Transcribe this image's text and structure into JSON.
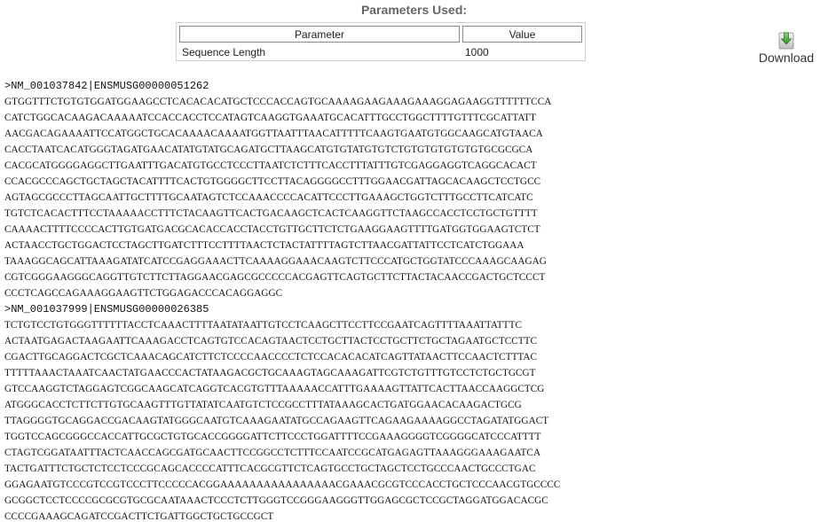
{
  "parameters": {
    "title": "Parameters Used:",
    "columns": [
      "Parameter",
      "Value"
    ],
    "rows": [
      {
        "parameter": "Sequence Length",
        "value": "1000"
      }
    ]
  },
  "download": {
    "label": "Download",
    "icon": "download-arrow-icon"
  },
  "records": [
    {
      "header": ">NM_001037842|ENSMUSG00000051262",
      "lines": [
        "GTGGTTTCTGTGTGGATGGAAGCCTCACACACATGCTCCCACCAGTGCAAAAGAAGAAAGAAAGGAGAAGGTTTTTTCCA",
        "CATCTGGCACAAGACAAAAATCCACCACCTCCATAGTCAAGGTGAAATGCACATTTGCCTGGCTTTTGTTTCGCATTATT",
        "AACGACAGAAAATTCCATGGCTGCACAAAACAAAATGGTTAATTTAACATTTTTCAAGTGAATGTGGCAAGCATGTAACA",
        "CACCTAATCACATGGGTAGATGAACATATGTATGCAGATGCTTAAGCATGTGTATGTGTCTGTGTGTGTGTGTGCGCGCA",
        "CACGCATGGGGAGGCTTGAATTTGACATGTGCCTCCCTTAATCTCTTTCACCTTTATTTGTCGAGGAGGTCAGGCACACT",
        "CCACGCCCAGCTGCTAGCTACATTTTCACTGTGGGGCTTCCTTACAGGGGCCTTTGGAACGATTAGCACAAGCTCCTGCC",
        "AGTAGCGCCCTTAGCAATTGCTTTTGCAATAGTCTCCAAACCCCACATTCCCTTGAAAGCTGGTCTTTGCCTTCATCATC",
        "TGTCTCACACTTTCCTAAAAACCTTTCTACAAGTTCACTGACAAGCTCACTCAAGGTTCTAAGCCACCTCCTGCTGTTTT",
        "CAAAACTTTTCCCCACTTGTGATGACGCACACCACCTACCTGTTGCTTCTCTGAAGGAAGTTTTGATGGTGGAAGTCTCT",
        "ACTAACCTGCTGGACTCCTAGCTTGATCTTTCCTTTTAACTCTACTATTTTAGTCTTAACGATTATTCCTCATCTGGAAA",
        "TAAAGGCAGCATTAAAGATATCATCCGAGGAAACTTCAAAAGGAAACAAGTCTTCCCATGCTGGTATCCCAAAGCAAGAG",
        "CGTCGGGAAGGGCAGGTTGTCTTCTTAGGAACGAGCGCCCCCACGAGTTCAGTGCTTCTTACTACAACCGACTGCTCCCT",
        "CCCTCAGCCAGAAAGGAAGTTCTGGAGACCCACAGGAGGC"
      ]
    },
    {
      "header": ">NM_001037999|ENSMUSG00000026385",
      "lines": [
        "TCTGTCCTGTGGGTTTTTTACCTCAAACTTTTAATATAATTGTCCTCAAGCTTCCTTCCGAATCAGTTTTAAATTATTTC",
        "ACTAATGAGACTAAGAATTCAAAGACCTCAGTGTCCACAGTAACTCCTGCTTACTCCTGCTTCTGCTAGAATGCTCCTTC",
        "CGACTTGCAGGACTCGCTCAAACAGCATCTTCTCCCCAACCCCTCTCCACACACATCAGTTATAACTTCCAACTCTTTAC",
        "TTTTTAAACTAAATCAACTATGAACCCACTATAAGACGCTGCAAAGTAGCAAAGATTCGTCTGTTTGTCCTCTGCTGCGT",
        "GTCCAAGGTCTAGGAGTCGGCAAGCATCAGGTCACGTGTTTAAAAACCATTTGAAAAGTTATTCACTTAACCAAGGCTCG",
        "ATGGGCACCTCTTCTTGTGCAAGTTTGTTATATCAATGTCTCCGCCTTTATAAAGCACTGATGGAACACAAGACTGCG",
        "TTAGGGGTGCAGGACCGACAAGTATGGGCAATGTCAAAGAATATGCCAGAAGTTCAGAAGAAAAGGCCTAGATATGGACT",
        "TGGTCCAGCGGGCCACCATTGCGCTGTGCACCGGGGATTCTTCCCTGGATTTTCCGAAAGGGGTCGGGGCATCCCATTTT",
        "CTAGTCGGATAATTTACTCAACCAGCGATGCAACTTCCGGCCTCTTTCCAATCCGCATGAGAGTTAAAGGGAAAGAATCA",
        "TACTGATTTCTGCTCTCCTCCCGCAGCACCCCATTTCACGCGTTCTCAGTGCCTGCTAGCTCCTGCCCAACTGCCCTGAC",
        "GGAGAATGTCCCGTCCGTCCCTTCCCCCACGGAAAAAAAAAAAAAAAACGAAACGCGTCCCACCTGCTCCCAACGTGCCCC",
        "GCGGCTCCTCCCCGCGCGTGCGCAATAAACTCCCTCTTGGGTCCGGGAAGGGTTGGAGCGCTCCGCTAGGATGGACACGC",
        "CCCCGAAAGCAGATCCGACTTCTGATTGGCTGCTGCCGCT"
      ]
    }
  ]
}
